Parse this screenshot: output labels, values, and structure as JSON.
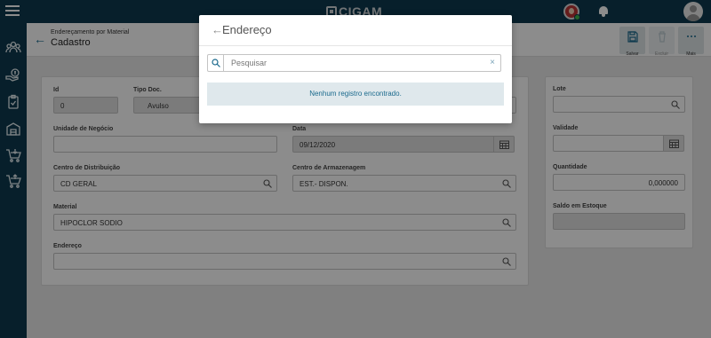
{
  "topbar": {
    "logo_text": "CIGAM",
    "menu_icon": "hamburger-icon",
    "bell_icon": "bell-icon",
    "profile_icon": "user-icon"
  },
  "header": {
    "breadcrumb": "Endereçamento por Material",
    "title": "Cadastro",
    "back_icon": "arrow-left-icon"
  },
  "toolbar": {
    "save_label": "Salvar",
    "delete_label": "Excluir",
    "more_label": "Mais"
  },
  "form": {
    "id_label": "Id",
    "id_value": "0",
    "tipo_doc_label": "Tipo Doc.",
    "tipo_doc_value": "Avulso",
    "unidade_label": "Unidade de Negócio",
    "unidade_value": "",
    "data_label": "Data",
    "data_value": "09/12/2020",
    "cd_label": "Centro de Distribuição",
    "cd_value": "CD GERAL",
    "ca_label": "Centro de Armazenagem",
    "ca_value": "EST.- DISPON.",
    "material_label": "Material",
    "material_value": "HIPOCLOR SODIO",
    "endereco_label": "Endereço",
    "endereco_value": ""
  },
  "side_form": {
    "lote_label": "Lote",
    "lote_value": "",
    "validade_label": "Validade",
    "validade_value": "",
    "quantidade_label": "Quantidade",
    "quantidade_value": "0,000000",
    "saldo_label": "Saldo em Estoque",
    "saldo_value": ""
  },
  "modal": {
    "title": "Endereço",
    "search_placeholder": "Pesquisar",
    "clear_symbol": "×",
    "empty_message": "Nenhum registro encontrado."
  },
  "colors": {
    "topbar": "#0d3a4f",
    "accent": "#1b6a8d",
    "empty_bg": "#dfe8ec"
  }
}
